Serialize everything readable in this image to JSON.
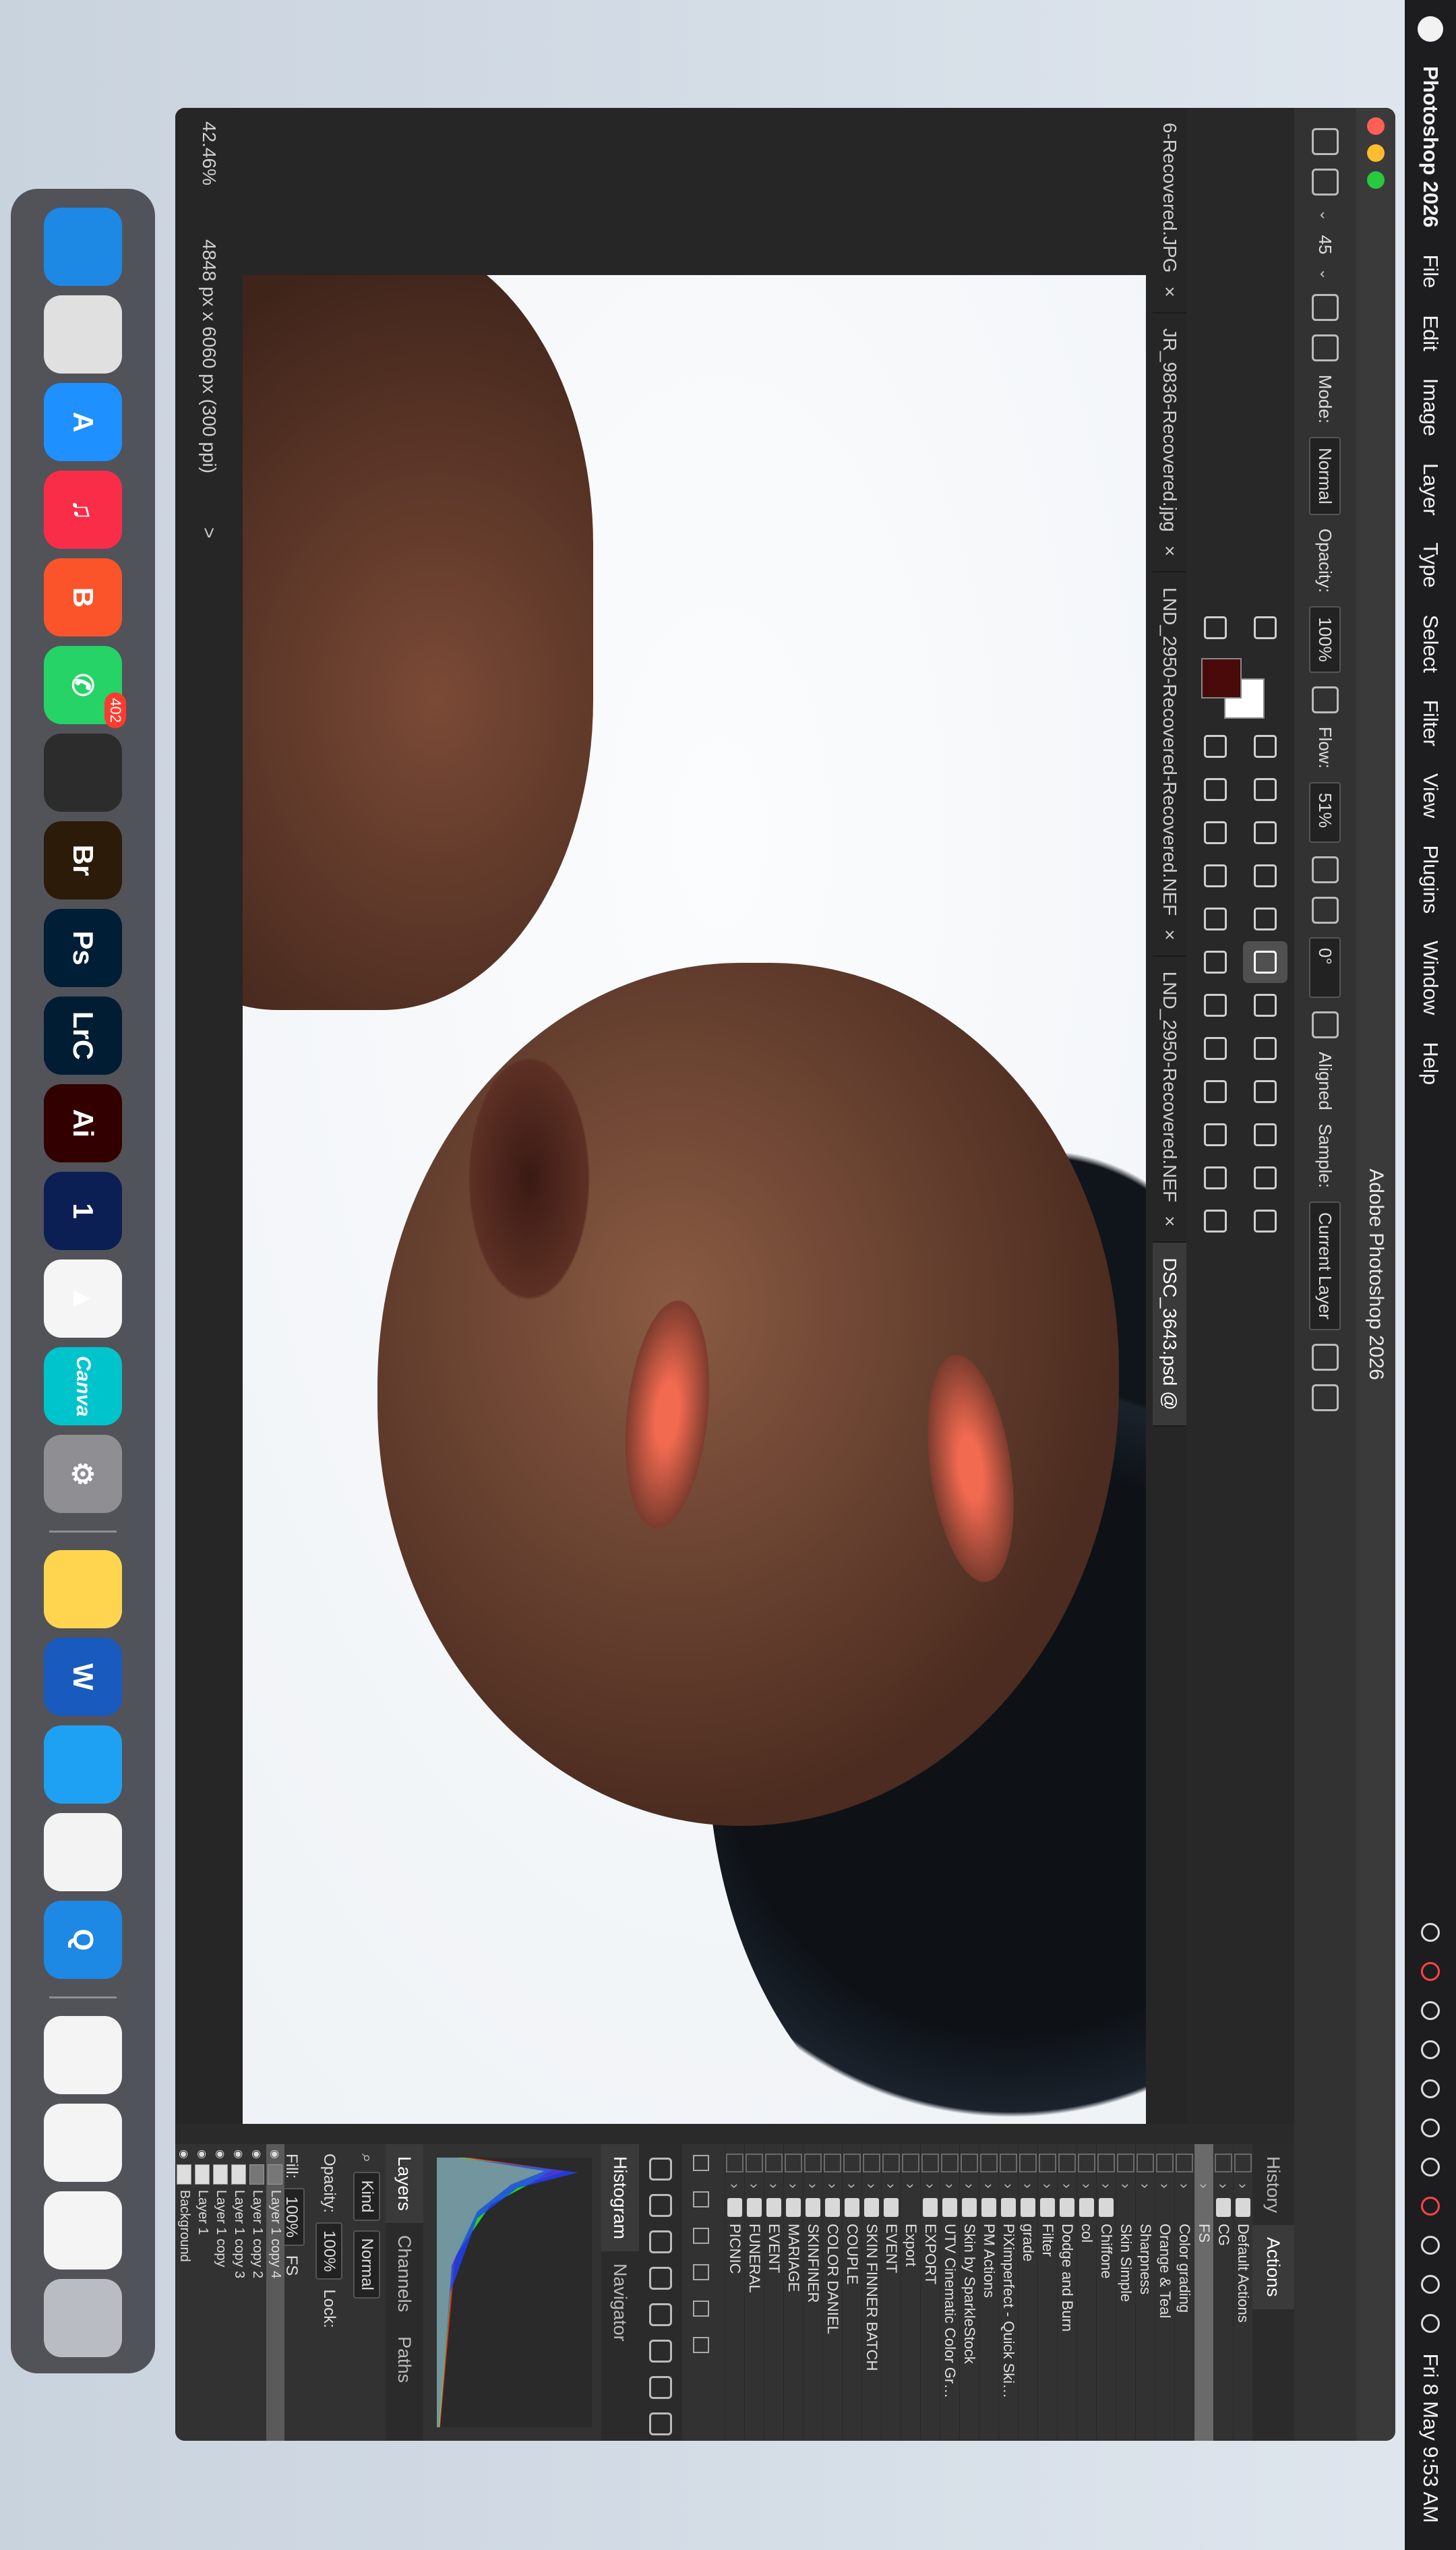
{
  "menubar": {
    "app_name": "Photoshop 2026",
    "items": [
      "File",
      "Edit",
      "Image",
      "Layer",
      "Type",
      "Select",
      "Filter",
      "View",
      "Plugins",
      "Window",
      "Help"
    ],
    "clock": "Fri 8 May  9:53 AM"
  },
  "window": {
    "title": "Adobe Photoshop 2026"
  },
  "options": {
    "size_value": "45",
    "mode_label": "Mode:",
    "mode_value": "Normal",
    "opacity_label": "Opacity:",
    "opacity_value": "100%",
    "flow_label": "Flow:",
    "flow_value": "51%",
    "angle_value": "0°",
    "aligned_label": "Aligned",
    "sample_label": "Sample:",
    "sample_value": "Current Layer"
  },
  "tabs": [
    {
      "label": "6-Recovered.JPG"
    },
    {
      "label": "JR_9836-Recovered.jpg"
    },
    {
      "label": "LND_2950-Recovered-Recovered.NEF"
    },
    {
      "label": "LND_2950-Recovered.NEF"
    },
    {
      "label": "DSC_3643.psd @"
    }
  ],
  "status": {
    "zoom": "42.46%",
    "dimensions": "4848 px x 6060 px (300 ppi)",
    "arrow": ">"
  },
  "actions_panel": {
    "tabs": [
      "History",
      "Actions"
    ],
    "items": [
      {
        "label": "Default Actions",
        "type": "set"
      },
      {
        "label": "CG",
        "type": "set"
      },
      {
        "label": "FS",
        "type": "action",
        "selected": true
      },
      {
        "label": "Color grading",
        "type": "action"
      },
      {
        "label": "Orange & Teal",
        "type": "action"
      },
      {
        "label": "Sharpness",
        "type": "action"
      },
      {
        "label": "Skin Simple",
        "type": "action"
      },
      {
        "label": "Chiffone",
        "type": "set"
      },
      {
        "label": "col",
        "type": "set"
      },
      {
        "label": "Dodge and Burn",
        "type": "set"
      },
      {
        "label": "Filter",
        "type": "set"
      },
      {
        "label": "grade",
        "type": "set"
      },
      {
        "label": "PiXimperfect - Quick Skin ...",
        "type": "set"
      },
      {
        "label": "PM Actions",
        "type": "set"
      },
      {
        "label": "Skin by SparkleStock",
        "type": "set"
      },
      {
        "label": "UTV Cinematic Color Grad...",
        "type": "set"
      },
      {
        "label": "EXPORT",
        "type": "set"
      },
      {
        "label": "Export",
        "type": "action"
      },
      {
        "label": "EVENT",
        "type": "set"
      },
      {
        "label": "SKIN FINNER BATCH",
        "type": "set"
      },
      {
        "label": "COUPLE",
        "type": "set"
      },
      {
        "label": "COLOR DANIEL",
        "type": "set"
      },
      {
        "label": "SKINFINER",
        "type": "set"
      },
      {
        "label": "MARIAGE",
        "type": "set"
      },
      {
        "label": "EVENT",
        "type": "set"
      },
      {
        "label": "FUNERAL",
        "type": "set"
      },
      {
        "label": "PICNIC",
        "type": "set"
      }
    ]
  },
  "histogram_panel": {
    "tabs": [
      "Histogram",
      "Navigator"
    ]
  },
  "layers_panel": {
    "tabs": [
      "Layers",
      "Channels",
      "Paths"
    ],
    "kind_label": "Kind",
    "blend_mode": "Normal",
    "opacity_label": "Opacity:",
    "opacity_value": "100%",
    "lock_label": "Lock:",
    "fill_label": "Fill:",
    "fill_value": "100%",
    "group_label": "FS",
    "layers": [
      {
        "name": "Layer 1 copy 4",
        "selected": true
      },
      {
        "name": "Layer 1 copy 2"
      },
      {
        "name": "Layer 1 copy 3"
      },
      {
        "name": "Layer 1 copy"
      },
      {
        "name": "Layer 1"
      },
      {
        "name": "Background"
      }
    ]
  },
  "dock": {
    "apps": [
      {
        "icon": "finder-icon",
        "glyph": "",
        "color": "#1e88e5"
      },
      {
        "icon": "launchpad-icon",
        "glyph": "",
        "color": "#e0e0e0"
      },
      {
        "icon": "app-store-icon",
        "glyph": "A",
        "color": "#1e90ff"
      },
      {
        "icon": "music-icon",
        "glyph": "♫",
        "color": "#fa2d48"
      },
      {
        "icon": "brave-icon",
        "glyph": "B",
        "color": "#fb542b"
      },
      {
        "icon": "whatsapp-icon",
        "glyph": "✆",
        "color": "#25d366",
        "badge": "402"
      },
      {
        "icon": "lightroom-classic-alt-icon",
        "glyph": "",
        "color": "#2c2c2c"
      },
      {
        "icon": "bridge-icon",
        "glyph": "Br",
        "color": "#2b1b08"
      },
      {
        "icon": "photoshop-icon",
        "glyph": "Ps",
        "color": "#001e36"
      },
      {
        "icon": "lightroom-classic-icon",
        "glyph": "LrC",
        "color": "#001d34"
      },
      {
        "icon": "illustrator-icon",
        "glyph": "Ai",
        "color": "#330000"
      },
      {
        "icon": "1password-icon",
        "glyph": "1",
        "color": "#0b1f54"
      },
      {
        "icon": "vlc-icon",
        "glyph": "▲",
        "color": "#f5f5f5"
      },
      {
        "icon": "canva-icon",
        "glyph": "Canva",
        "color": "#00c4cc"
      },
      {
        "icon": "system-settings-icon",
        "glyph": "⚙",
        "color": "#8e8e93"
      },
      {
        "icon": "notes-icon",
        "glyph": "",
        "color": "#ffd54f"
      },
      {
        "icon": "word-icon",
        "glyph": "W",
        "color": "#185abd"
      },
      {
        "icon": "safari-icon",
        "glyph": "",
        "color": "#1ea1f2"
      },
      {
        "icon": "microsoft-store-icon",
        "glyph": "",
        "color": "#f3f3f3"
      },
      {
        "icon": "quicktime-icon",
        "glyph": "Q",
        "color": "#1e88e5"
      }
    ]
  }
}
